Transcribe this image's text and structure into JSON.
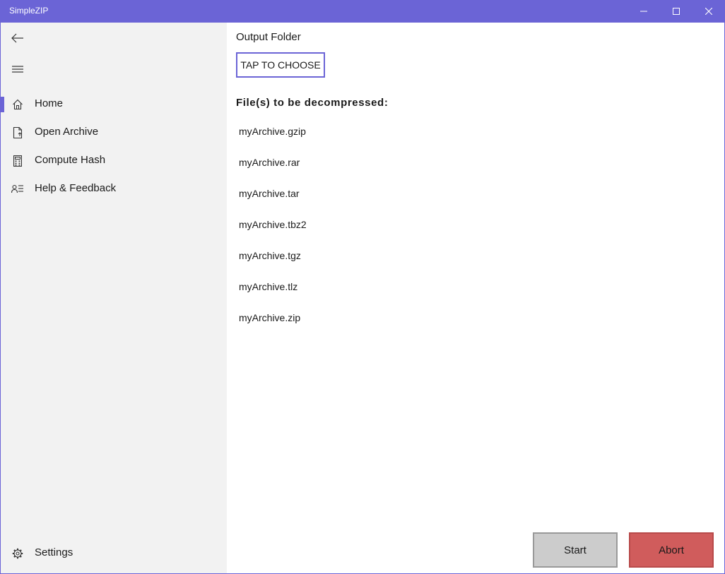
{
  "window": {
    "title": "SimpleZIP",
    "accent_color": "#6b64d6"
  },
  "sidebar": {
    "back_icon": "back-arrow-icon",
    "menu_icon": "hamburger-menu-icon",
    "items": [
      {
        "label": "Home",
        "icon": "home-icon",
        "selected": true
      },
      {
        "label": "Open Archive",
        "icon": "document-icon",
        "selected": false
      },
      {
        "label": "Compute Hash",
        "icon": "calculator-icon",
        "selected": false
      },
      {
        "label": "Help & Feedback",
        "icon": "contact-info-icon",
        "selected": false
      }
    ],
    "settings": {
      "label": "Settings",
      "icon": "gear-icon"
    }
  },
  "main": {
    "output_folder_label": "Output Folder",
    "choose_button_label": "TAP TO CHOOSE",
    "files_heading": "File(s) to be decompressed:",
    "files": [
      "myArchive.gzip",
      "myArchive.rar",
      "myArchive.tar",
      "myArchive.tbz2",
      "myArchive.tgz",
      "myArchive.tlz",
      "myArchive.zip"
    ],
    "start_label": "Start",
    "abort_label": "Abort",
    "abort_color": "#d05c5c"
  }
}
